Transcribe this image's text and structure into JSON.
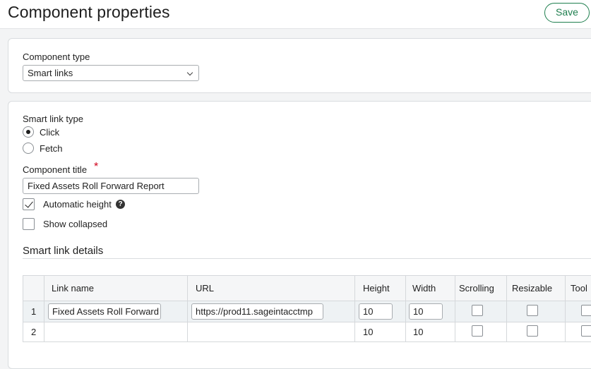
{
  "header": {
    "title": "Component properties",
    "save_label": "Save"
  },
  "component_type": {
    "label": "Component type",
    "selected": "Smart links"
  },
  "smart_link_type": {
    "label": "Smart link type",
    "options": [
      {
        "label": "Click",
        "checked": true
      },
      {
        "label": "Fetch",
        "checked": false
      }
    ]
  },
  "component_title": {
    "label": "Component title",
    "required_mark": "*",
    "value": "Fixed Assets Roll Forward Report"
  },
  "automatic_height": {
    "label": "Automatic height",
    "checked": true,
    "help_glyph": "?"
  },
  "show_collapsed": {
    "label": "Show collapsed",
    "checked": false
  },
  "details": {
    "title": "Smart link details",
    "columns": [
      "Link name",
      "URL",
      "Height",
      "Width",
      "Scrolling",
      "Resizable",
      "Tool"
    ],
    "rows": [
      {
        "num": "1",
        "link_name": "Fixed Assets Roll Forward",
        "url": "https://prod11.sageintacctmp",
        "height": "10",
        "width": "10"
      },
      {
        "num": "2",
        "link_name": "",
        "url": "",
        "height": "10",
        "width": "10"
      }
    ]
  },
  "colors": {
    "accent": "#1f7f4f",
    "required": "#d0021b"
  }
}
